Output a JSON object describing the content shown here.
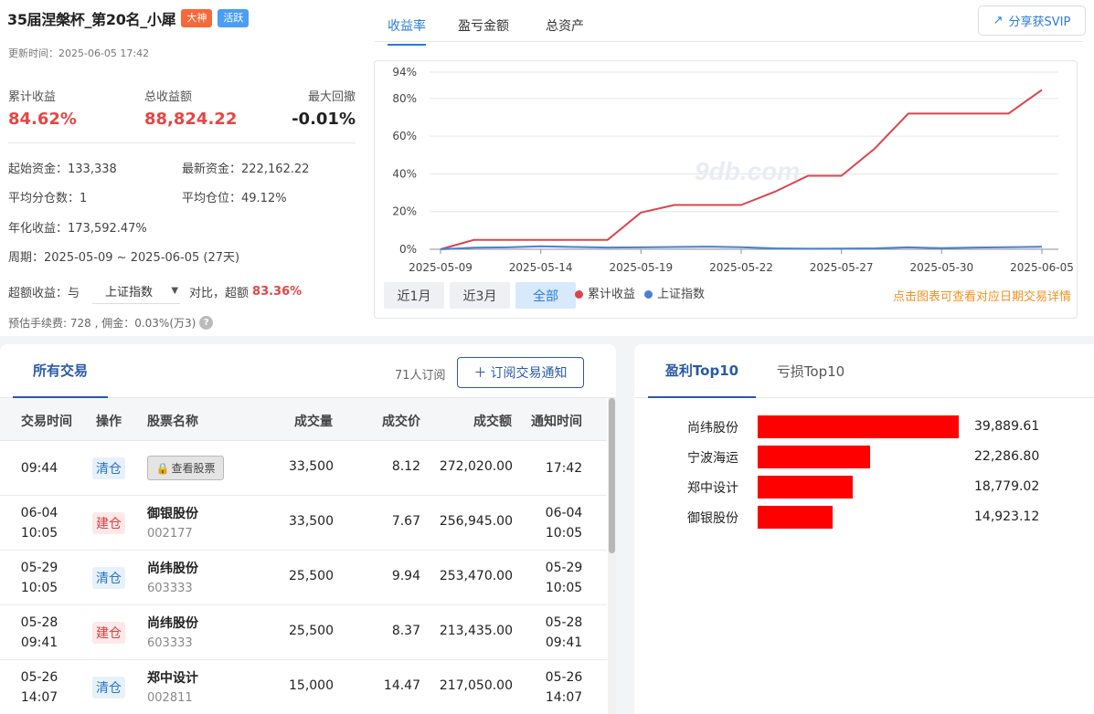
{
  "header": {
    "title": "35届涅槃杯_第20名_小犀",
    "badge_1": "大神",
    "badge_2": "活跃",
    "update_time": "更新时间：2025-06-05 17:42"
  },
  "kpis": {
    "cum_label": "累计收益",
    "cum_value": "84.62%",
    "total_label": "总收益额",
    "total_value": "88,824.22",
    "drawdown_label": "最大回撤",
    "drawdown_value": "-0.01%"
  },
  "info": {
    "start_capital": "起始资金：133,338",
    "latest_capital": "最新资金：222,162.22",
    "avg_split": "平均分仓数：1",
    "avg_position": "平均仓位：49.12%",
    "annual": "年化收益：173,592.47%",
    "period": "周期：2025-05-09 ~ 2025-06-05 (27天)"
  },
  "excess": {
    "label": "超额收益：与",
    "benchmark": "上证指数",
    "mid": "对比，超额",
    "value": "83.36%"
  },
  "fee": {
    "text": "预估手续费: 728 , 佣金：0.03%(万3)",
    "help": "?"
  },
  "chart_tabs": [
    "收益率",
    "盈亏金额",
    "总资产"
  ],
  "share_label": "分享获SVIP",
  "range_buttons": [
    "近1月",
    "近3月",
    "全部"
  ],
  "legend": {
    "series_1": "累计收益",
    "series_2": "上证指数"
  },
  "chart_hint": "点击图表可查看对应日期交易详情",
  "watermark": "9db.com",
  "colors": {
    "series_1": "#d9454b",
    "series_2": "#4a7fd6",
    "accent_blue": "#2a7bd8",
    "up_red": "#e54545",
    "bar_red": "#fe0000",
    "hint_orange": "#f39122"
  },
  "chart_data": {
    "type": "line",
    "x": [
      "2025-05-09",
      "2025-05-12",
      "2025-05-13",
      "2025-05-14",
      "2025-05-15",
      "2025-05-16",
      "2025-05-19",
      "2025-05-20",
      "2025-05-21",
      "2025-05-22",
      "2025-05-23",
      "2025-05-26",
      "2025-05-27",
      "2025-05-28",
      "2025-05-29",
      "2025-05-30",
      "2025-06-03",
      "2025-06-04",
      "2025-06-05"
    ],
    "x_ticks": [
      "2025-05-09",
      "2025-05-14",
      "2025-05-19",
      "2025-05-22",
      "2025-05-27",
      "2025-05-30",
      "2025-06-05"
    ],
    "y_ticks": [
      "0%",
      "20%",
      "40%",
      "60%",
      "80%",
      "94%"
    ],
    "y_tick_values": [
      0,
      20,
      40,
      60,
      80,
      94
    ],
    "ylim": [
      0,
      94
    ],
    "series": [
      {
        "name": "累计收益",
        "values": [
          0,
          5,
          5,
          5,
          5,
          5,
          19.5,
          23.5,
          23.5,
          23.5,
          30.5,
          39,
          39,
          53.5,
          72,
          72,
          72,
          72,
          84.62
        ]
      },
      {
        "name": "上证指数",
        "values": [
          0,
          0.8,
          1.0,
          1.6,
          1.2,
          0.9,
          1.0,
          1.2,
          1.4,
          1.1,
          0.5,
          0.3,
          0.4,
          0.5,
          1.0,
          0.6,
          0.9,
          1.1,
          1.3
        ]
      }
    ],
    "grid": true,
    "legend": "bottom"
  },
  "trades": {
    "tab_label": "所有交易",
    "subscribers": "71人订阅",
    "subscribe_button": "订阅交易通知",
    "columns": [
      "交易时间",
      "操作",
      "股票名称",
      "成交量",
      "成交价",
      "成交额",
      "通知时间"
    ],
    "view_button": "查看股票",
    "rows": [
      {
        "date": "",
        "time": "09:44",
        "op": "清仓",
        "op_type": "close",
        "name": "",
        "code": "",
        "hidden": true,
        "volume": "33,500",
        "price": "8.12",
        "amount": "272,020.00",
        "notify_date": "",
        "notify_time": "17:42"
      },
      {
        "date": "06-04",
        "time": "10:05",
        "op": "建仓",
        "op_type": "open",
        "name": "御银股份",
        "code": "002177",
        "hidden": false,
        "volume": "33,500",
        "price": "7.67",
        "amount": "256,945.00",
        "notify_date": "06-04",
        "notify_time": "10:05"
      },
      {
        "date": "05-29",
        "time": "10:05",
        "op": "清仓",
        "op_type": "close",
        "name": "尚纬股份",
        "code": "603333",
        "hidden": false,
        "volume": "25,500",
        "price": "9.94",
        "amount": "253,470.00",
        "notify_date": "05-29",
        "notify_time": "10:05"
      },
      {
        "date": "05-28",
        "time": "09:41",
        "op": "建仓",
        "op_type": "open",
        "name": "尚纬股份",
        "code": "603333",
        "hidden": false,
        "volume": "25,500",
        "price": "8.37",
        "amount": "213,435.00",
        "notify_date": "05-28",
        "notify_time": "09:41"
      },
      {
        "date": "05-26",
        "time": "14:07",
        "op": "清仓",
        "op_type": "close",
        "name": "郑中设计",
        "code": "002811",
        "hidden": false,
        "volume": "15,000",
        "price": "14.47",
        "amount": "217,050.00",
        "notify_date": "05-26",
        "notify_time": "14:07"
      }
    ]
  },
  "top10": {
    "tab_profit": "盈利Top10",
    "tab_loss": "亏损Top10",
    "items": [
      {
        "name": "尚纬股份",
        "value": 39889.61,
        "label": "39,889.61"
      },
      {
        "name": "宁波海运",
        "value": 22286.8,
        "label": "22,286.80"
      },
      {
        "name": "郑中设计",
        "value": 18779.02,
        "label": "18,779.02"
      },
      {
        "name": "御银股份",
        "value": 14923.12,
        "label": "14,923.12"
      }
    ]
  }
}
